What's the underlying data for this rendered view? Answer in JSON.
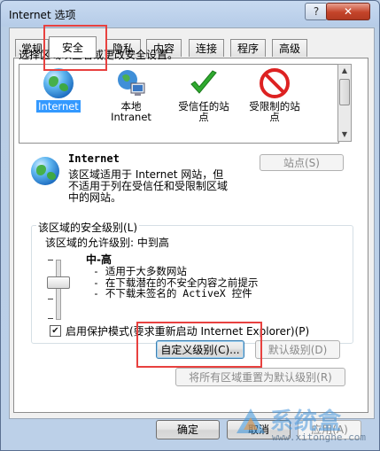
{
  "window": {
    "title": "Internet 选项",
    "help_label": "?",
    "close_label": "✕"
  },
  "tabs": [
    {
      "label": "常规"
    },
    {
      "label": "安全",
      "active": true
    },
    {
      "label": "隐私"
    },
    {
      "label": "内容"
    },
    {
      "label": "连接"
    },
    {
      "label": "程序"
    },
    {
      "label": "高级"
    }
  ],
  "security": {
    "instruction": "选择区域以查看或更改安全设置。",
    "zones": [
      {
        "label": "Internet",
        "icon": "globe-icon",
        "selected": true
      },
      {
        "label": "本地\nIntranet",
        "icon": "intranet-icon"
      },
      {
        "label": "受信任的站\n点",
        "icon": "checkmark-icon"
      },
      {
        "label": "受限制的站\n点",
        "icon": "restricted-icon"
      }
    ],
    "selected_zone_title": "Internet",
    "selected_zone_description": "该区域适用于 Internet 网站，但\n不适用于列在受信任和受限制区域\n中的网站。",
    "sites_button": "站点(S)",
    "level_group_label": "该区域的安全级别(L)",
    "allowed_levels": "该区域的允许级别: 中到高",
    "level_name": "中-高",
    "level_points": [
      "- 适用于大多数网站",
      "- 在下载潜在的不安全内容之前提示",
      "- 不下载未签名的 ActiveX 控件"
    ],
    "protected_mode_label": "启用保护模式(要求重新启动 Internet Explorer)(P)",
    "protected_mode_checked": true,
    "custom_level_button": "自定义级别(C)...",
    "default_level_button": "默认级别(D)",
    "reset_all_button": "将所有区域重置为默认级别(R)"
  },
  "footer": {
    "ok_button": "确定",
    "cancel_button": "取消",
    "apply_button": "应用(A)"
  },
  "watermark": {
    "brand": "系统盒",
    "url": "www.xitonghe.com"
  },
  "colors": {
    "highlight": "#e8413f",
    "selection": "#3399ff"
  }
}
